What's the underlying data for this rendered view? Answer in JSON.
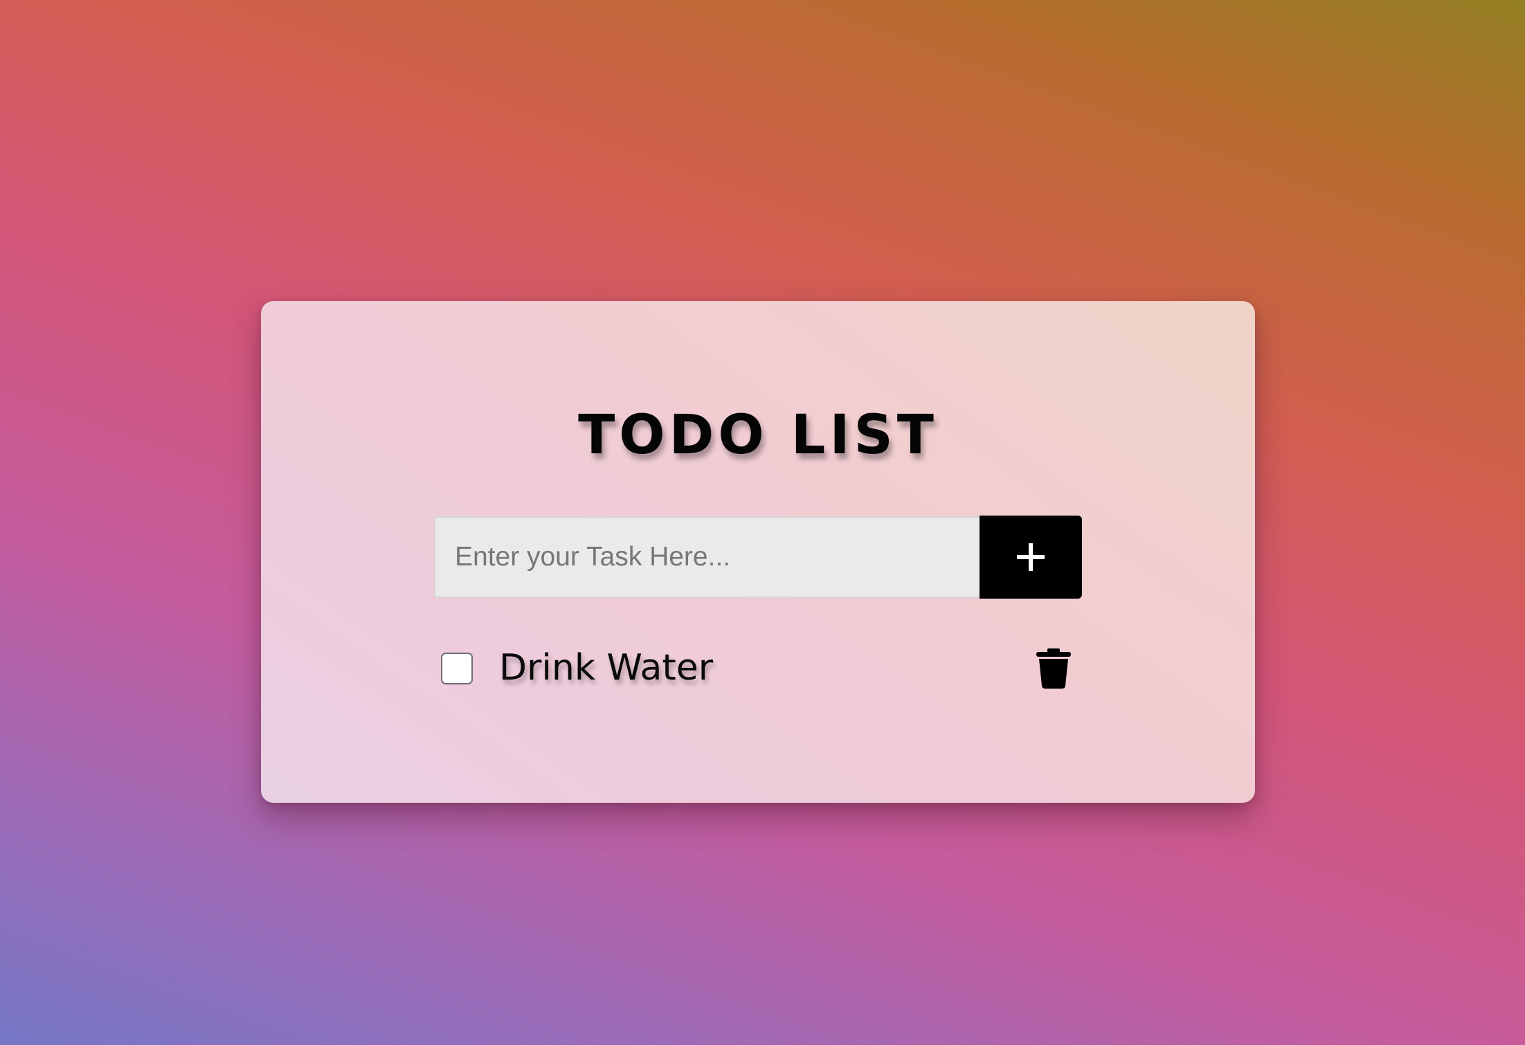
{
  "app": {
    "title": "TODO LIST"
  },
  "input": {
    "placeholder": "Enter your Task Here...",
    "value": ""
  },
  "add_button": {
    "icon": "plus-icon"
  },
  "todos": [
    {
      "label": "Drink Water",
      "checked": false,
      "delete_icon": "trash-icon"
    }
  ],
  "colors": {
    "accent": "#000000",
    "button_icon": "#ffffff",
    "input_background": "#ebe9ea"
  }
}
